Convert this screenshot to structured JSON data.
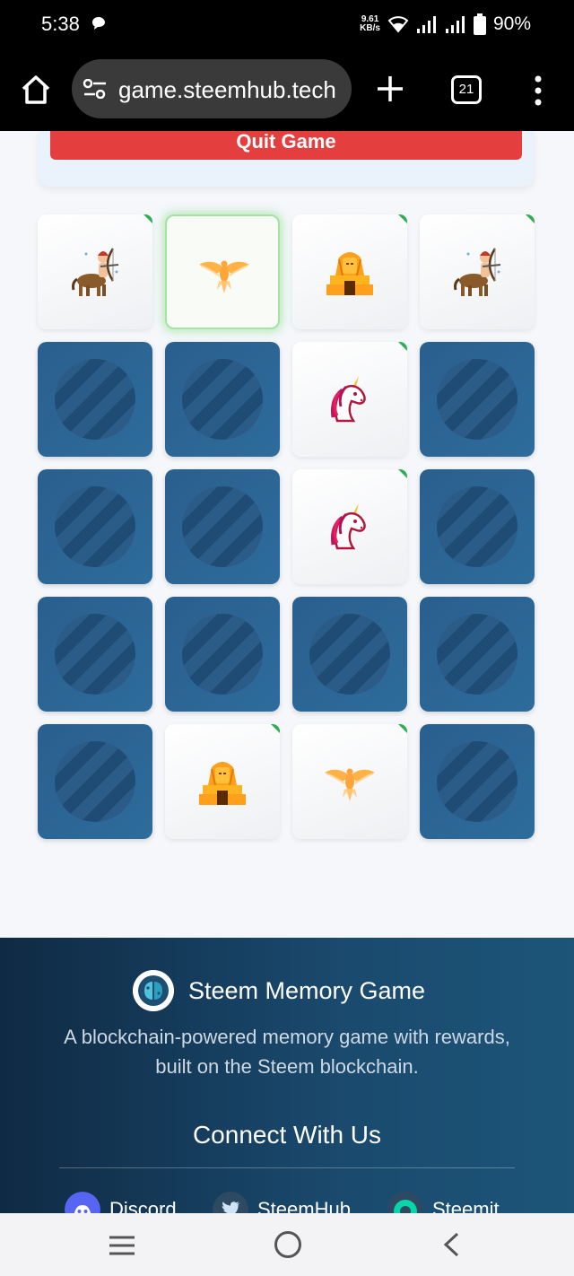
{
  "status_bar": {
    "time": "5:38",
    "net_speed_value": "9.61",
    "net_speed_unit": "KB/s",
    "battery": "90%"
  },
  "browser": {
    "url": "game.steemhub.tech",
    "tab_count": "21"
  },
  "game": {
    "quit_label": "Quit Game",
    "cards": [
      {
        "state": "revealed",
        "symbol": "centaur-archer",
        "matched": true
      },
      {
        "state": "revealed",
        "symbol": "phoenix",
        "matched": false,
        "active": true
      },
      {
        "state": "revealed",
        "symbol": "sphinx",
        "matched": true
      },
      {
        "state": "revealed",
        "symbol": "centaur-archer",
        "matched": true
      },
      {
        "state": "hidden"
      },
      {
        "state": "hidden"
      },
      {
        "state": "revealed",
        "symbol": "unicorn",
        "matched": true
      },
      {
        "state": "hidden"
      },
      {
        "state": "hidden"
      },
      {
        "state": "hidden"
      },
      {
        "state": "revealed",
        "symbol": "unicorn",
        "matched": true
      },
      {
        "state": "hidden"
      },
      {
        "state": "hidden"
      },
      {
        "state": "hidden"
      },
      {
        "state": "hidden"
      },
      {
        "state": "hidden"
      },
      {
        "state": "hidden"
      },
      {
        "state": "revealed",
        "symbol": "sphinx",
        "matched": true
      },
      {
        "state": "revealed",
        "symbol": "phoenix",
        "matched": true
      },
      {
        "state": "hidden"
      }
    ]
  },
  "footer": {
    "brand_name": "Steem Memory Game",
    "tagline": "A blockchain-powered memory game with rewards, built on the Steem blockchain.",
    "connect_heading": "Connect With Us",
    "social": [
      {
        "label": "Discord",
        "icon": "discord-icon",
        "color": "#5865f2"
      },
      {
        "label": "SteemHub",
        "icon": "twitter-icon",
        "color": "#1da1f2"
      },
      {
        "label": "Steemit",
        "icon": "steemit-icon",
        "color": "#06d6a9"
      }
    ]
  },
  "colors": {
    "quit_button": "#e53e3e",
    "card_back": "#2d6c9c",
    "match_tick": "#2fae55",
    "footer_bg": "#1a4a6e"
  }
}
